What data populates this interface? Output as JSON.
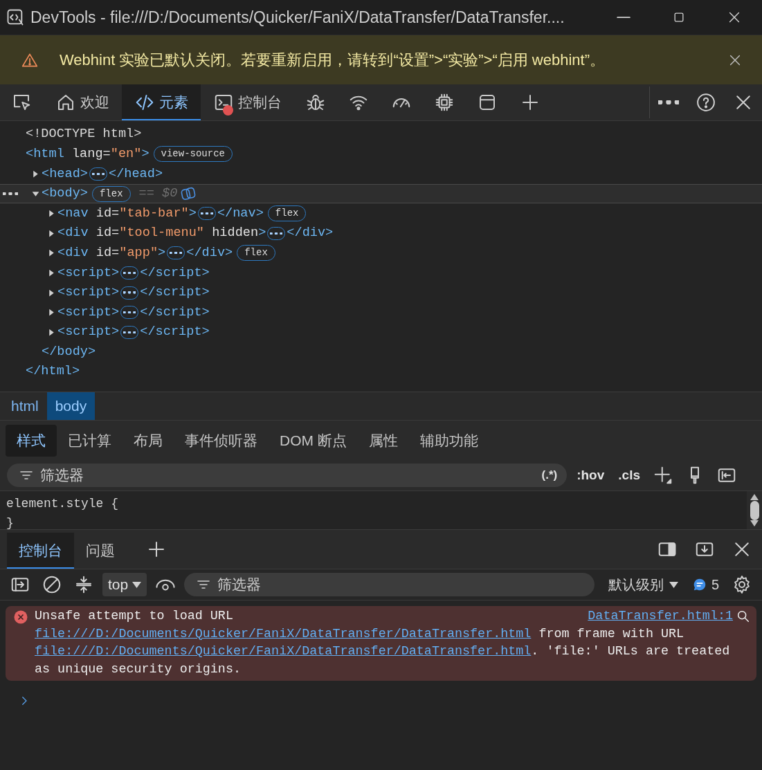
{
  "window": {
    "title": "DevTools - file:///D:/Documents/Quicker/FaniX/DataTransfer/DataTransfer...."
  },
  "infobar": {
    "message": "Webhint 实验已默认关闭。若要重新启用，请转到“设置”>“实验”>“启用 webhint”。"
  },
  "main_tabs": [
    {
      "kind": "inspect",
      "selected": false,
      "error_badge": false
    },
    {
      "kind": "home",
      "label": "欢迎",
      "selected": false,
      "error_badge": false
    },
    {
      "kind": "code",
      "label": "元素",
      "selected": true,
      "error_badge": false
    },
    {
      "kind": "console",
      "label": "控制台",
      "selected": false,
      "error_badge": true
    },
    {
      "kind": "bug",
      "selected": false,
      "error_badge": false
    },
    {
      "kind": "wifi",
      "selected": false,
      "error_badge": false
    },
    {
      "kind": "gauge",
      "selected": false,
      "error_badge": false
    },
    {
      "kind": "chip",
      "selected": false,
      "error_badge": false
    },
    {
      "kind": "window",
      "selected": false,
      "error_badge": false
    },
    {
      "kind": "plus",
      "selected": false,
      "error_badge": false
    }
  ],
  "dom_tree": [
    {
      "selected": false,
      "parts": [
        {
          "kind": "doctype",
          "text": "<!DOCTYPE html>"
        }
      ]
    },
    {
      "selected": false,
      "parts": [
        {
          "kind": "code",
          "text": "<html lang=\"en\">"
        },
        {
          "kind": "badge",
          "text": "view-source"
        }
      ],
      "close": "</html>",
      "children": [
        {
          "selected": false,
          "expanded": false,
          "parts": [
            {
              "kind": "code",
              "text": "<head>"
            },
            {
              "kind": "ellipsis"
            },
            {
              "kind": "code",
              "text": "</head>"
            }
          ]
        },
        {
          "selected": true,
          "expanded": true,
          "parts": [
            {
              "kind": "code",
              "text": "<body>"
            },
            {
              "kind": "badge",
              "text": "flex"
            },
            {
              "kind": "hint",
              "text": "== $0"
            },
            {
              "kind": "ai_button"
            }
          ],
          "close": "</body>",
          "children": [
            {
              "selected": false,
              "expanded": false,
              "parts": [
                {
                  "kind": "code",
                  "text": "<nav id=\"tab-bar\">"
                },
                {
                  "kind": "ellipsis"
                },
                {
                  "kind": "code",
                  "text": "</nav>"
                },
                {
                  "kind": "badge",
                  "text": "flex"
                }
              ]
            },
            {
              "selected": false,
              "expanded": false,
              "parts": [
                {
                  "kind": "code",
                  "text": "<div id=\"tool-menu\" hidden>"
                },
                {
                  "kind": "ellipsis"
                },
                {
                  "kind": "code",
                  "text": "</div>"
                }
              ]
            },
            {
              "selected": false,
              "expanded": false,
              "parts": [
                {
                  "kind": "code",
                  "text": "<div id=\"app\">"
                },
                {
                  "kind": "ellipsis"
                },
                {
                  "kind": "code",
                  "text": "</div>"
                },
                {
                  "kind": "badge",
                  "text": "flex"
                }
              ]
            },
            {
              "selected": false,
              "expanded": false,
              "parts": [
                {
                  "kind": "code",
                  "text": "<script>"
                },
                {
                  "kind": "ellipsis"
                },
                {
                  "kind": "code",
                  "text": "</script>"
                }
              ]
            },
            {
              "selected": false,
              "expanded": false,
              "parts": [
                {
                  "kind": "code",
                  "text": "<script>"
                },
                {
                  "kind": "ellipsis"
                },
                {
                  "kind": "code",
                  "text": "</script>"
                }
              ]
            },
            {
              "selected": false,
              "expanded": false,
              "parts": [
                {
                  "kind": "code",
                  "text": "<script>"
                },
                {
                  "kind": "ellipsis"
                },
                {
                  "kind": "code",
                  "text": "</script>"
                }
              ]
            },
            {
              "selected": false,
              "expanded": false,
              "parts": [
                {
                  "kind": "code",
                  "text": "<script>"
                },
                {
                  "kind": "ellipsis"
                },
                {
                  "kind": "code",
                  "text": "</script>"
                }
              ]
            }
          ]
        }
      ]
    }
  ],
  "breadcrumbs": [
    {
      "label": "html",
      "selected": false
    },
    {
      "label": "body",
      "selected": true
    }
  ],
  "styles_tabs": [
    {
      "label": "样式",
      "selected": true
    },
    {
      "label": "已计算",
      "selected": false
    },
    {
      "label": "布局",
      "selected": false
    },
    {
      "label": "事件侦听器",
      "selected": false
    },
    {
      "label": "DOM 断点",
      "selected": false
    },
    {
      "label": "属性",
      "selected": false
    },
    {
      "label": "辅助功能",
      "selected": false
    }
  ],
  "styles_toolbar": {
    "placeholder": "筛选器",
    "regex": "(.*)",
    "hov": ":hov",
    "cls": ".cls"
  },
  "styles_rules": [
    "element.style {",
    "}"
  ],
  "drawer_tabs": [
    {
      "label": "控制台",
      "selected": true
    },
    {
      "label": "问题",
      "selected": false
    }
  ],
  "console_toolbar": {
    "context": "top",
    "placeholder": "筛选器",
    "level": "默认级别",
    "message_count": "5"
  },
  "messages": [
    {
      "kind": "error",
      "source": "DataTransfer.html:1",
      "segments": [
        {
          "kind": "text",
          "text": "Unsafe attempt to load URL "
        },
        {
          "kind": "link",
          "text": "file:///D:/Documents/Quicker/FaniX/DataTransfer/DataTransfer.html"
        },
        {
          "kind": "text",
          "text": " from frame with URL "
        },
        {
          "kind": "link",
          "text": "file:///D:/Documents/Quicker/FaniX/DataTransfer/DataTransfer.html"
        },
        {
          "kind": "text",
          "text": ". 'file:' URLs are treated as unique security origins."
        }
      ]
    }
  ]
}
